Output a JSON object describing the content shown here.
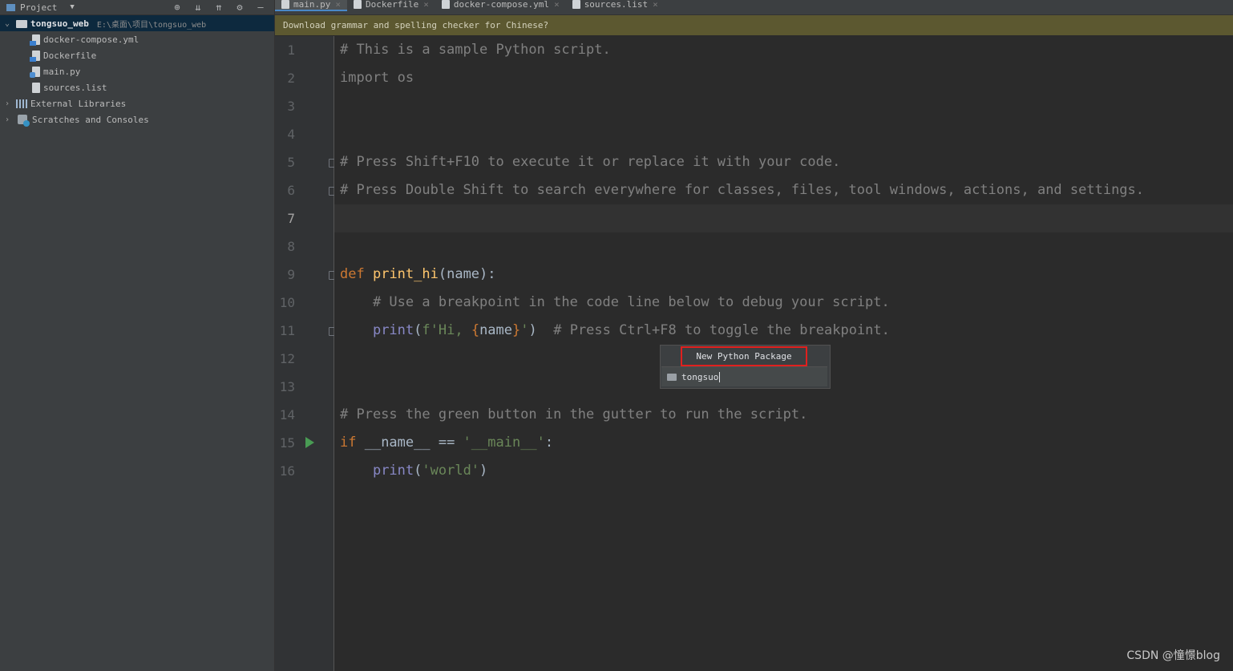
{
  "sidebar": {
    "header_label": "Project",
    "tree": [
      {
        "label": "tongsuo_web",
        "path": "E:\\桌面\\项目\\tongsuo_web",
        "type": "folder",
        "expanded": true,
        "selected": true
      },
      {
        "label": "docker-compose.yml",
        "type": "yml-file"
      },
      {
        "label": "Dockerfile",
        "type": "file"
      },
      {
        "label": "main.py",
        "type": "python-file"
      },
      {
        "label": "sources.list",
        "type": "file"
      },
      {
        "label": "External Libraries",
        "type": "libraries"
      },
      {
        "label": "Scratches and Consoles",
        "type": "scratches"
      }
    ]
  },
  "tabs": [
    {
      "label": "main.py",
      "active": true
    },
    {
      "label": "Dockerfile"
    },
    {
      "label": "docker-compose.yml"
    },
    {
      "label": "sources.list"
    }
  ],
  "banner": "Download grammar and spelling checker for Chinese?",
  "editor": {
    "current_line": 7,
    "line_numbers": [
      "1",
      "2",
      "3",
      "4",
      "5",
      "6",
      "7",
      "8",
      "9",
      "10",
      "11",
      "12",
      "13",
      "14",
      "15",
      "16"
    ]
  },
  "popup": {
    "title": "New Python Package",
    "input_value": "tongsuo"
  },
  "watermark": "CSDN @憧憬blog",
  "colors": {
    "accent_red": "#e0201e",
    "run_green": "#499c54",
    "banner_bg": "#5c5830"
  }
}
